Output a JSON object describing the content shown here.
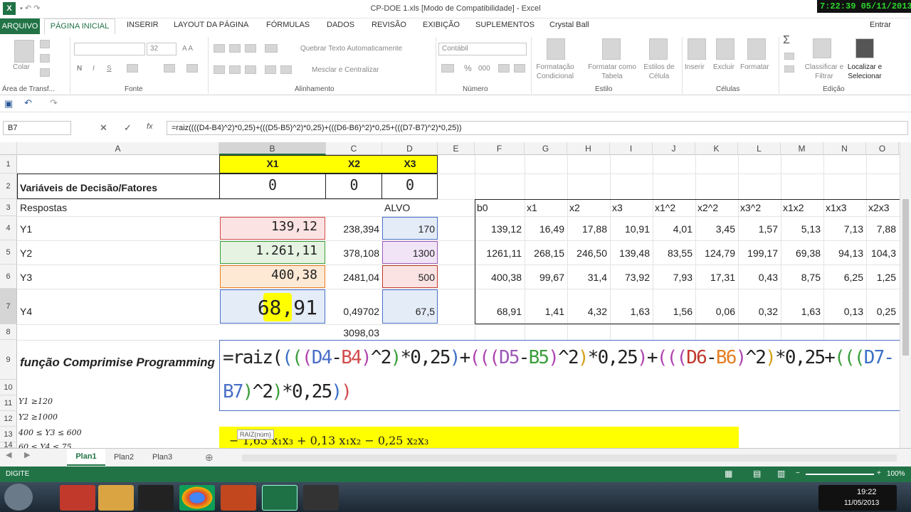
{
  "window": {
    "title": "CP-DOE 1.xls  [Modo de Compatibilidade] - Excel",
    "clock": "7:22:39  05/11/2013"
  },
  "ribbon_tabs": [
    "ARQUIVO",
    "PÁGINA INICIAL",
    "INSERIR",
    "LAYOUT DA PÁGINA",
    "FÓRMULAS",
    "DADOS",
    "REVISÃO",
    "EXIBIÇÃO",
    "SUPLEMENTOS",
    "Crystal Ball"
  ],
  "account": "Entrar",
  "ribbon": {
    "paste": "Colar",
    "clipboard": "Área de Transf...",
    "font_size": "32",
    "font_group": "Fonte",
    "bold": "N",
    "italic": "I",
    "underline": "S",
    "wrap": "Quebrar Texto Automaticamente",
    "merge": "Mesclar e Centralizar",
    "align_group": "Alinhamento",
    "number_format": "Contábil",
    "number_group": "Número",
    "percent": "%",
    "thousands": "000",
    "cond_format": "Formatação Condicional",
    "format_table": "Formatar como Tabela",
    "cell_styles": "Estilos de Célula",
    "style_group": "Estilo",
    "insert": "Inserir",
    "delete": "Excluir",
    "format": "Formatar",
    "cells_group": "Células",
    "sort": "Classificar e Filtrar",
    "find": "Localizar e Selecionar",
    "edit_group": "Edição",
    "sigma": "Σ"
  },
  "formula_bar": {
    "name_box": "B7",
    "fx": "fx",
    "formula": "=raiz((((D4-B4)^2)*0,25)+(((D5-B5)^2)*0,25)+(((D6-B6)^2)*0,25+(((D7-B7)^2)*0,25))"
  },
  "columns": [
    "A",
    "B",
    "C",
    "D",
    "E",
    "F",
    "G",
    "H",
    "I",
    "J",
    "K",
    "L",
    "M",
    "N",
    "O"
  ],
  "rows": [
    "1",
    "2",
    "3",
    "4",
    "5",
    "6",
    "7",
    "8",
    "9",
    "10",
    "11",
    "12",
    "13",
    "14"
  ],
  "cells": {
    "B1": "X1",
    "C1": "X2",
    "D1": "X3",
    "A2": "Variáveis de Decisão/Fatores",
    "B2": "0",
    "C2": "0",
    "D2": "0",
    "A3": "Respostas",
    "D3": "ALVO",
    "A4": "Y1",
    "B4": "139,12",
    "C4": "238,394",
    "D4": "170",
    "A5": "Y2",
    "B5": "1.261,11",
    "C5": "378,108",
    "D5": "1300",
    "A6": "Y3",
    "B6": "400,38",
    "C6": "2481,04",
    "D6": "500",
    "A7": "Y4",
    "B7": "68,91",
    "C7": "0,49702",
    "D7": "67,5",
    "C8": "3098,03",
    "A9": "função Comprimise Programming",
    "A11": "Y1 ≥120",
    "A12": "Y2 ≥1000",
    "A13": "400 ≤ Y3 ≤ 600",
    "A14": "60 ≤ Y4 ≤ 75"
  },
  "coef_table": {
    "headers": [
      "b0",
      "x1",
      "x2",
      "x3",
      "x1^2",
      "x2^2",
      "x3^2",
      "x1x2",
      "x1x3",
      "x2x3"
    ],
    "rows": [
      [
        "139,12",
        "16,49",
        "17,88",
        "10,91",
        "4,01",
        "3,45",
        "1,57",
        "5,13",
        "7,13",
        "7,88"
      ],
      [
        "1261,11",
        "268,15",
        "246,50",
        "139,48",
        "83,55",
        "124,79",
        "199,17",
        "69,38",
        "94,13",
        "104,3"
      ],
      [
        "400,38",
        "99,67",
        "31,4",
        "73,92",
        "7,93",
        "17,31",
        "0,43",
        "8,75",
        "6,25",
        "1,25"
      ],
      [
        "68,91",
        "1,41",
        "4,32",
        "1,63",
        "1,56",
        "0,06",
        "0,32",
        "1,63",
        "0,13",
        "0,25"
      ]
    ]
  },
  "edit_formula": {
    "line1": [
      {
        "t": "=raiz(",
        "c": "#222"
      },
      {
        "t": "(",
        "c": "#3a6fc7"
      },
      {
        "t": "(",
        "c": "#3a9e3a"
      },
      {
        "t": "(",
        "c": "#b044b0"
      },
      {
        "t": "D4",
        "c": "#4a6fc7"
      },
      {
        "t": "-",
        "c": "#222"
      },
      {
        "t": "B4",
        "c": "#d24b4b"
      },
      {
        "t": ")",
        "c": "#b044b0"
      },
      {
        "t": "^2",
        "c": "#222"
      },
      {
        "t": ")",
        "c": "#3a9e3a"
      },
      {
        "t": "*0,25",
        "c": "#222"
      },
      {
        "t": ")",
        "c": "#3a6fc7"
      },
      {
        "t": "+",
        "c": "#222"
      },
      {
        "t": "(((",
        "c": "#b044b0"
      },
      {
        "t": "D5",
        "c": "#9b59b6"
      },
      {
        "t": "-",
        "c": "#222"
      },
      {
        "t": "B5",
        "c": "#3a9e3a"
      },
      {
        "t": ")",
        "c": "#b044b0"
      },
      {
        "t": "^2",
        "c": "#222"
      },
      {
        "t": ")",
        "c": "#d4a017"
      },
      {
        "t": "*0,25",
        "c": "#222"
      },
      {
        "t": ")",
        "c": "#b044b0"
      },
      {
        "t": "+",
        "c": "#222"
      },
      {
        "t": "(((",
        "c": "#b044b0"
      },
      {
        "t": "D6",
        "c": "#c0392b"
      },
      {
        "t": "-",
        "c": "#222"
      },
      {
        "t": "B6",
        "c": "#e67e22"
      },
      {
        "t": ")",
        "c": "#b044b0"
      },
      {
        "t": "^2",
        "c": "#222"
      },
      {
        "t": ")",
        "c": "#d4a017"
      },
      {
        "t": "*0,25+",
        "c": "#222"
      },
      {
        "t": "(((",
        "c": "#3a9e3a"
      },
      {
        "t": "D7-",
        "c": "#3a6fc7"
      }
    ],
    "line2": [
      {
        "t": "B7",
        "c": "#4a6fc7"
      },
      {
        "t": ")",
        "c": "#3a9e3a"
      },
      {
        "t": "^2",
        "c": "#222"
      },
      {
        "t": ")",
        "c": "#3a9e3a"
      },
      {
        "t": "*0,25",
        "c": "#222"
      },
      {
        "t": ")",
        "c": "#3a6fc7"
      },
      {
        "t": ")",
        "c": "#d24b4b"
      }
    ]
  },
  "tooltip": "RAIZ(núm)",
  "equation_strip": "− 1,63 x₁x₃  + 0,13 x₁x₂  − 0,25 x₂x₃",
  "sheets": [
    "Plan1",
    "Plan2",
    "Plan3"
  ],
  "status": {
    "mode": "DIGITE",
    "zoom": "100%"
  },
  "taskbar": {
    "time": "19:22",
    "date": "11/05/2013"
  },
  "colors": {
    "excel_green": "#217346",
    "yellow": "#ffff00"
  }
}
